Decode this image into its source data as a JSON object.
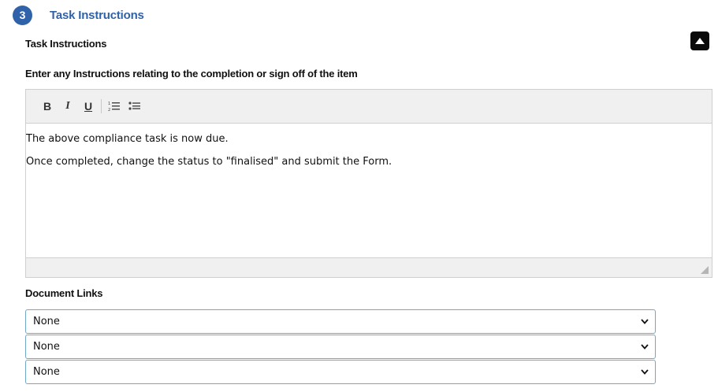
{
  "section": {
    "step_number": "3",
    "title": "Task Instructions"
  },
  "labels": {
    "task_instructions": "Task Instructions",
    "enter_instructions": "Enter any Instructions relating to the completion or sign off of the item",
    "document_links": "Document Links"
  },
  "toolbar": {
    "bold": "B",
    "italic": "I",
    "underline": "U",
    "icons": [
      "ordered-list-icon",
      "unordered-list-icon"
    ]
  },
  "editor": {
    "paragraphs": [
      "The above compliance task is now due.",
      "Once completed, change the status to \"finalised\" and submit the Form."
    ]
  },
  "document_links": [
    {
      "selected": "None"
    },
    {
      "selected": "None"
    },
    {
      "selected": "None"
    }
  ],
  "colors": {
    "accent": "#2f62a8",
    "select_border": "#6fa8c9",
    "toolbar_bg": "#f0f0f0"
  }
}
